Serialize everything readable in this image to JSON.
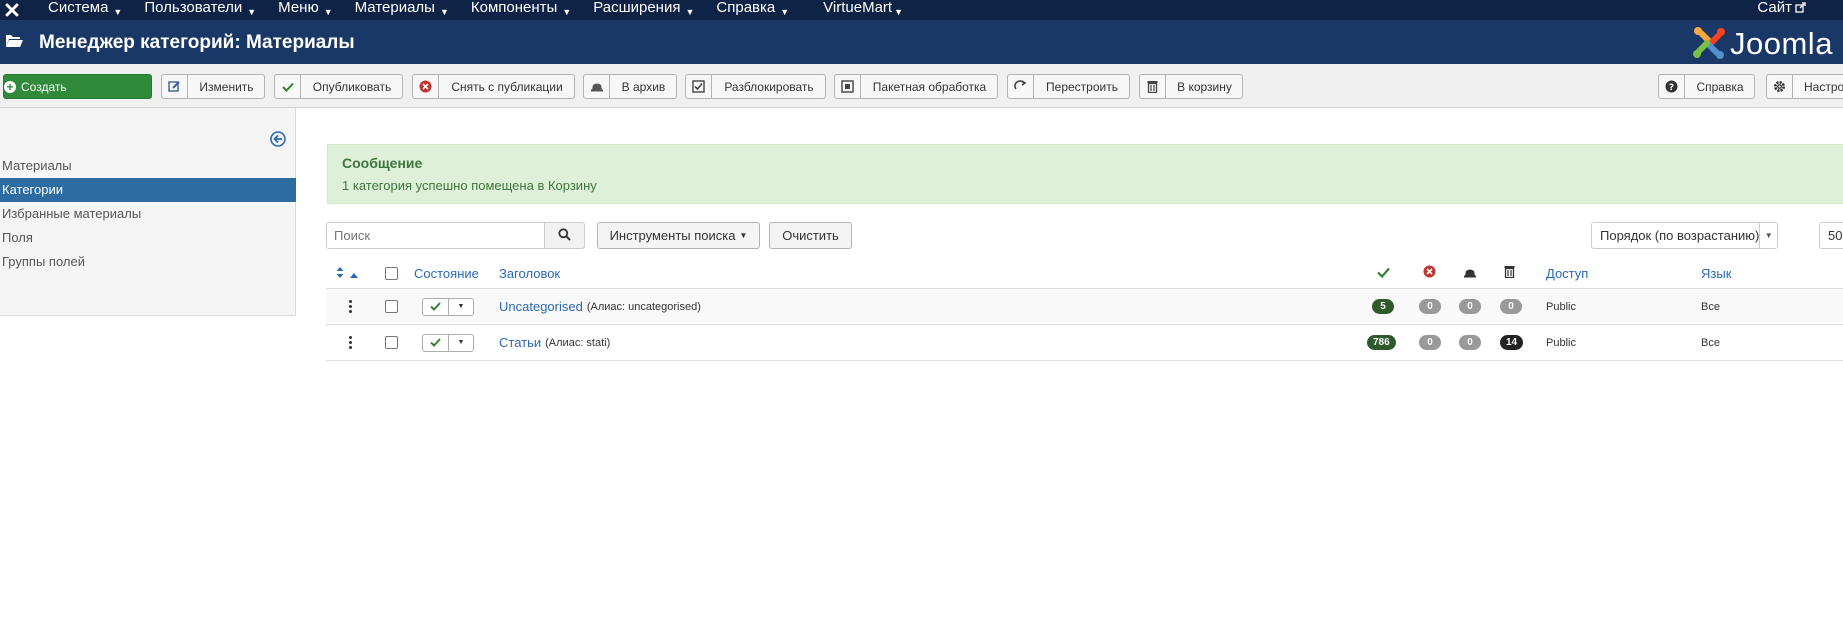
{
  "topnav": {
    "items": [
      {
        "label": "Система"
      },
      {
        "label": "Пользователи"
      },
      {
        "label": "Меню"
      },
      {
        "label": "Материалы"
      },
      {
        "label": "Компоненты"
      },
      {
        "label": "Расширения"
      },
      {
        "label": "Справка"
      },
      {
        "label": "VirtueMart"
      }
    ],
    "site_label": "Сайт"
  },
  "header": {
    "title": "Менеджер категорий: Материалы",
    "brand": "Joomla"
  },
  "toolbar": {
    "create": "Создать",
    "edit": "Изменить",
    "publish": "Опубликовать",
    "unpublish": "Снять с публикации",
    "archive": "В архив",
    "checkin": "Разблокировать",
    "batch": "Пакетная обработка",
    "rebuild": "Перестроить",
    "trash": "В корзину",
    "help": "Справка",
    "options": "Настройки"
  },
  "sidebar": {
    "items": [
      {
        "label": "Материалы",
        "active": false
      },
      {
        "label": "Категории",
        "active": true
      },
      {
        "label": "Избранные материалы",
        "active": false
      },
      {
        "label": "Поля",
        "active": false
      },
      {
        "label": "Группы полей",
        "active": false
      }
    ]
  },
  "alert": {
    "heading": "Сообщение",
    "message": "1 категория успешно помещена в Корзину"
  },
  "filters": {
    "search_placeholder": "Поиск",
    "search_tools": "Инструменты поиска",
    "clear": "Очистить",
    "ordering": "Порядок (по возрастанию)",
    "limit": "50"
  },
  "table": {
    "columns": {
      "status": "Состояние",
      "title": "Заголовок",
      "access": "Доступ",
      "language": "Язык"
    },
    "rows": [
      {
        "title": "Uncategorised",
        "alias": "(Алиас: uncategorised)",
        "published": "5",
        "unpublished": "0",
        "archived": "0",
        "trashed": "0",
        "access": "Public",
        "language": "Все"
      },
      {
        "title": "Статьи",
        "alias": "(Алиас: stati)",
        "published": "786",
        "unpublished": "0",
        "archived": "0",
        "trashed": "14",
        "access": "Public",
        "language": "Все"
      }
    ]
  },
  "colors": {
    "topnav_bg": "#0f2346",
    "header_bg": "#1a3867",
    "create_green": "#2f8a3a",
    "active_blue": "#2d6ca2",
    "link_blue": "#2a69b8",
    "alert_bg": "#dff0d8"
  }
}
